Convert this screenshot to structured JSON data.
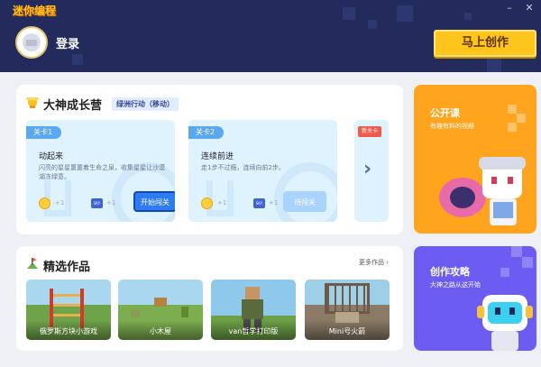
{
  "app": {
    "logo_text": "迷你编程"
  },
  "window_controls": {
    "minimize": "–",
    "close": "✕"
  },
  "header": {
    "login_label": "登录",
    "create_button": "马上创作"
  },
  "growth_camp": {
    "title": "大神成长营",
    "tag": "绿洲行动（移动）",
    "levels": [
      {
        "badge": "关卡1",
        "title": "动起来",
        "desc": "闪亮的星星噩噩着生命之泉，收集星星让沙漠湖冻绿意。",
        "coin_reward": "+1",
        "chip_reward": "+1",
        "chip_text": "SKY",
        "button": "开始闯关"
      },
      {
        "badge": "关卡2",
        "title": "连续前进",
        "desc": "走1步不过瘾，连续向前2步。",
        "coin_reward": "+1",
        "chip_reward": "+1",
        "chip_text": "SKY",
        "button": "待闯关"
      }
    ],
    "new_level_badge": "新关卡",
    "next_arrow": "›"
  },
  "featured": {
    "title": "精选作品",
    "more_link": "更多作品 ›",
    "items": [
      {
        "label": "俄罗斯方块小游戏"
      },
      {
        "label": "小木屋"
      },
      {
        "label": "van哲学打印版"
      },
      {
        "label": "Mini号火箭"
      }
    ]
  },
  "side_cards": {
    "course": {
      "title": "公开课",
      "subtitle": "有趣有料的视频"
    },
    "guide": {
      "title": "创作攻略",
      "subtitle": "大神之路从这开始"
    }
  },
  "colors": {
    "header_bg": "#232b5c",
    "accent_yellow": "#ffc51d",
    "course_orange": "#ffa41c",
    "guide_purple": "#6d5cf2",
    "primary_blue": "#2f7cf0"
  }
}
